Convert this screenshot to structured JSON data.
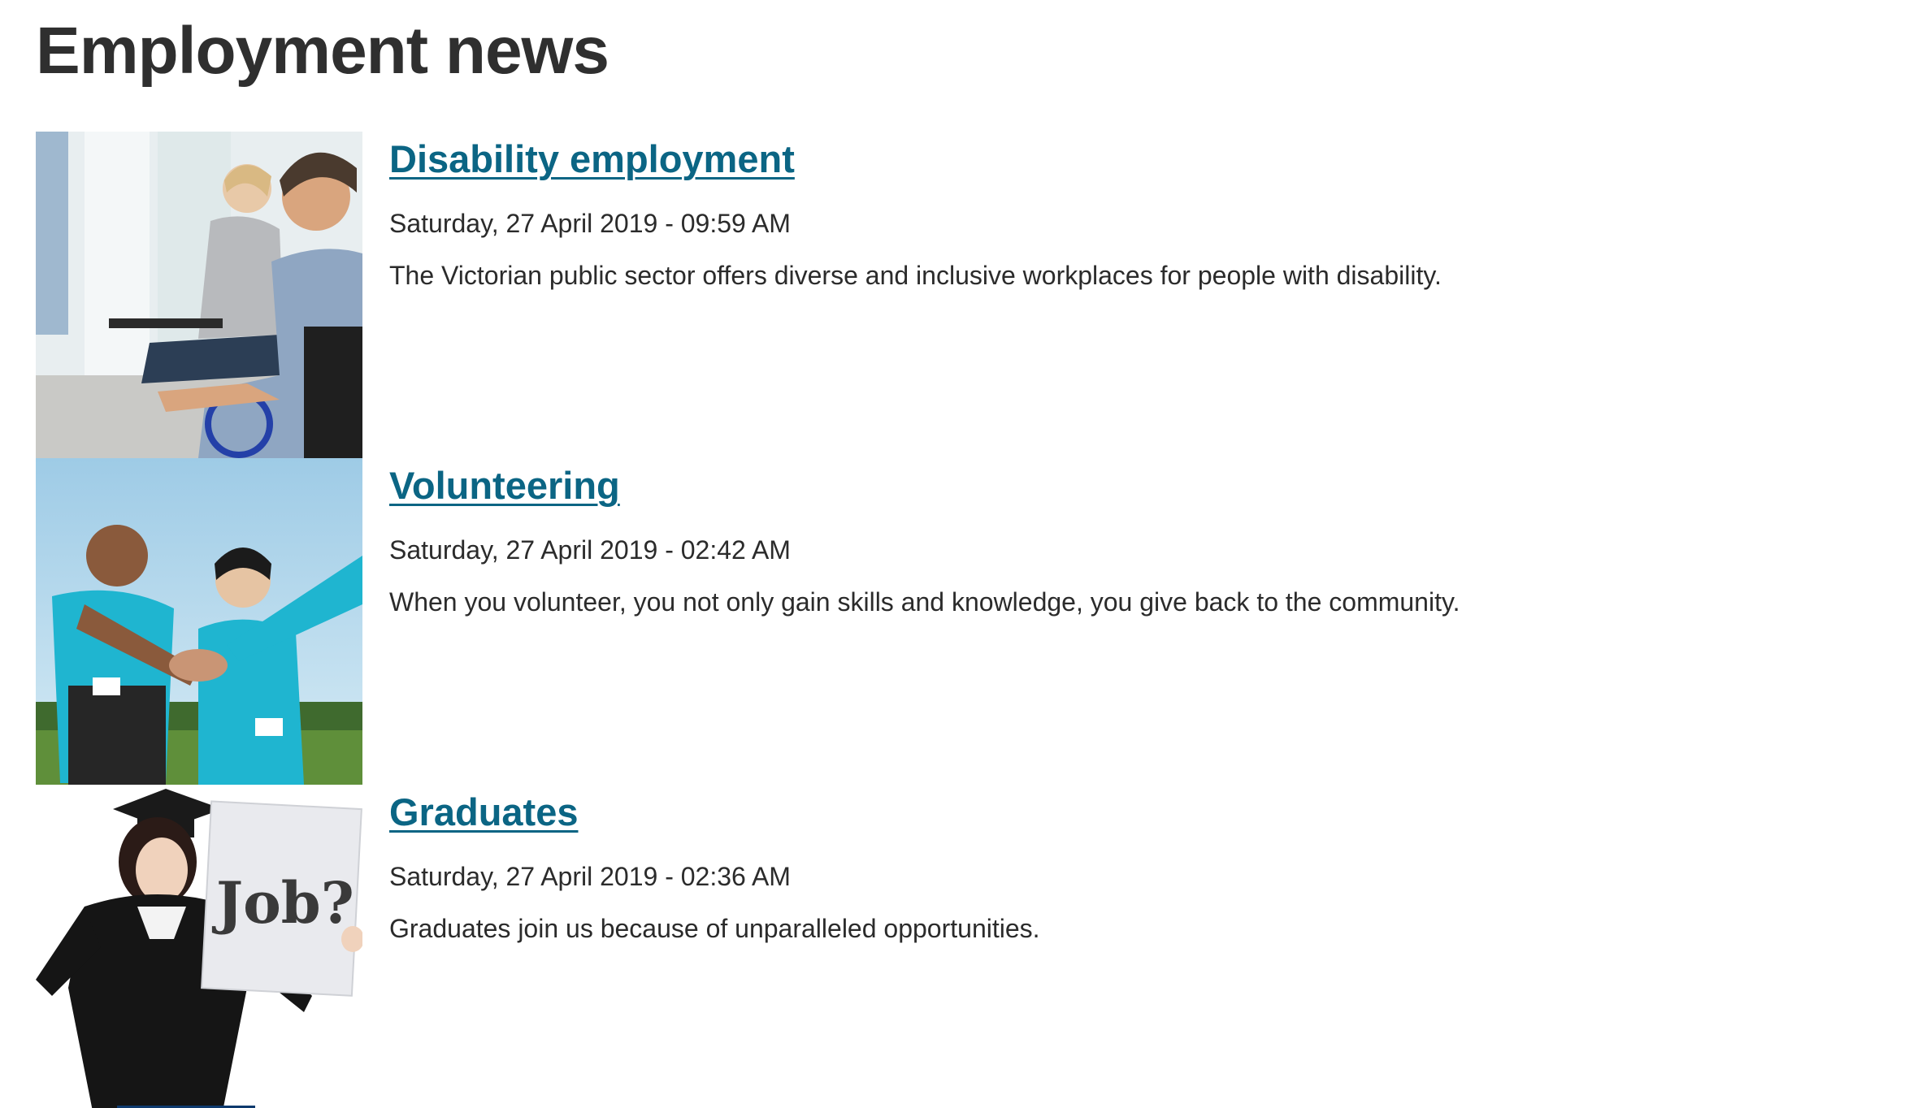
{
  "page": {
    "title": "Employment news"
  },
  "news": [
    {
      "title": "Disability employment",
      "date": "Saturday, 27 April 2019 - 09:59 AM",
      "summary": "The Victorian public sector offers diverse and inclusive workplaces for people with disability."
    },
    {
      "title": "Volunteering",
      "date": "Saturday, 27 April 2019 - 02:42 AM",
      "summary": "When you volunteer, you not only gain skills and knowledge, you give back to the community."
    },
    {
      "title": "Graduates",
      "date": "Saturday, 27 April 2019 - 02:36 AM",
      "summary": "Graduates join us because of unparalleled opportunities.",
      "image_sign_text": "Job?"
    }
  ],
  "colors": {
    "link": "#0b6584",
    "text": "#2b2b2b",
    "heading": "#2f2f2f"
  }
}
